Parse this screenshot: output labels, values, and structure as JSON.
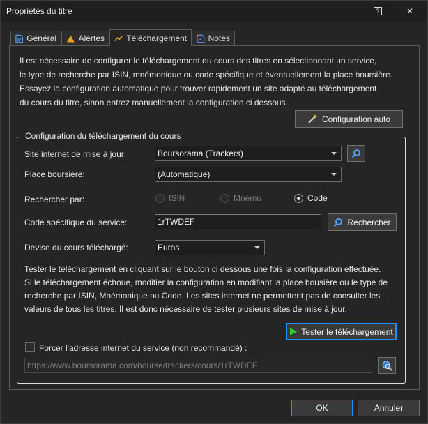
{
  "window": {
    "title": "Propriétés du titre",
    "help_label": "?",
    "close_label": "✕"
  },
  "tabs": [
    {
      "label": "Général",
      "icon": "document-icon"
    },
    {
      "label": "Alertes",
      "icon": "warning-icon"
    },
    {
      "label": "Téléchargement",
      "icon": "chart-line-icon",
      "active": true
    },
    {
      "label": "Notes",
      "icon": "note-icon"
    }
  ],
  "intro": {
    "lines": [
      "Il est nécessaire de configurer le téléchargement du cours des titres en sélectionnant un service,",
      "le type de recherche par ISIN, mnémonique ou code spécifique et éventuellement la place boursière.",
      "Essayez la configuration automatique pour trouver rapidement un site adapté au téléchargement",
      "du cours du titre, sinon entrez manuellement la configuration ci dessous."
    ]
  },
  "auto_config_button": {
    "label": "Configuration auto",
    "icon": "magic-wand-icon"
  },
  "group": {
    "title": "Configuration du téléchargement du cours",
    "site_label": "Site internet de mise à jour:",
    "site_value": "Boursorama (Trackers)",
    "place_label": "Place boursière:",
    "place_value": "(Automatique)",
    "search_by_label": "Rechercher par:",
    "radios": [
      {
        "label": "ISIN",
        "enabled": false,
        "checked": false
      },
      {
        "label": "Mnémo",
        "enabled": false,
        "checked": false
      },
      {
        "label": "Code",
        "enabled": true,
        "checked": true
      }
    ],
    "code_label": "Code spécifique du service:",
    "code_value": "1rTWDEF",
    "search_button_label": "Rechercher",
    "currency_label": "Devise du cours téléchargé:",
    "currency_value": "Euros",
    "test_text_lines": [
      "Tester le téléchargement en cliquant sur le bouton ci dessous une fois la configuration effectuée.",
      "Si le téléchargement échoue, modifier la configuration en modifiant la place bousière ou le type de",
      "recherche par ISIN, Mnémonique ou Code. Les sites internet ne permettent pas de consulter les",
      "valeurs de tous les titres. Il est donc nécessaire de tester plusieurs sites de mise à jour."
    ],
    "test_button_label": "Tester le téléchargement",
    "force_checkbox_label": "Forcer l'adresse internet du service (non recommandé) :",
    "url_placeholder": "https://www.boursorama.com/bourse/trackers/cours/1rTWDEF"
  },
  "footer": {
    "ok_label": "OK",
    "cancel_label": "Annuler"
  },
  "colors": {
    "accent": "#1e90ff",
    "play_green": "#3cc33c",
    "warning_orange": "#f0a020"
  }
}
